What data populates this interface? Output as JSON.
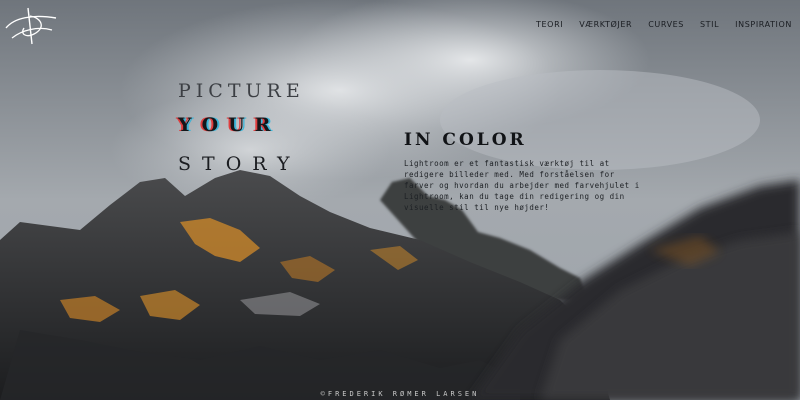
{
  "logo": {
    "icon": "signature-logo-icon"
  },
  "nav": {
    "items": [
      {
        "label": "TEORI"
      },
      {
        "label": "VÆRKTØJER"
      },
      {
        "label": "CURVES"
      },
      {
        "label": "STIL"
      },
      {
        "label": "INSPIRATION"
      }
    ]
  },
  "hero": {
    "line1": "PICTURE",
    "line2": "YOUR",
    "line3": "STORY",
    "heading": "IN COLOR",
    "text": "Lightroom er et fantastisk værktøj til at redigere billeder med. Med forståelsen for farver og hvordan du arbejder med farvehjulet i Lightroom, kan du tage din redigering og din visuelle stil til nye højder!"
  },
  "footer": {
    "credit": "©FREDERIK RØMER LARSEN"
  },
  "colors": {
    "sky": "#8d939a",
    "rock": "#3a3b3d",
    "lichen": "#c9862a",
    "text": "#15171a"
  }
}
